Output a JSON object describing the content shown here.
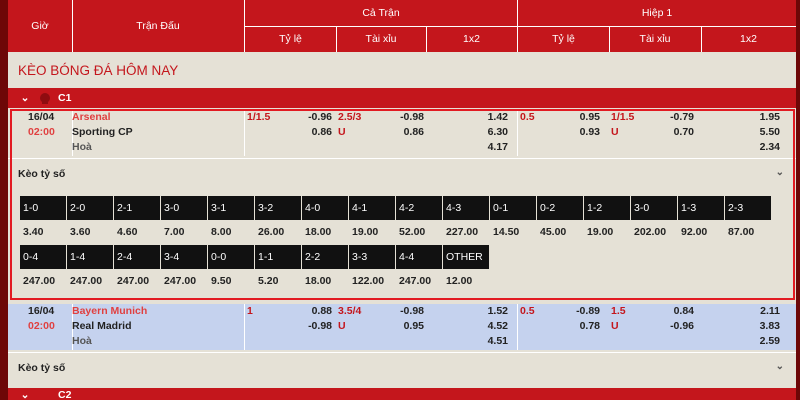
{
  "header": {
    "time": "Giờ",
    "match": "Trận Đấu",
    "full_time": "Cả Trận",
    "first_half": "Hiệp 1",
    "handicap": "Tỷ lệ",
    "over_under": "Tài xỉu",
    "one_x_two": "1x2",
    "handicap_h1": "Tỷ lệ",
    "over_under_h1": "Tài xỉu",
    "one_x_two_h1": "1x2"
  },
  "title": "KÈO BÓNG ĐÁ HÔM NAY",
  "colors": {
    "primary_red": "#c4161c",
    "highlight_blue": "#c5d2ee",
    "background": "#e5e1d6"
  },
  "leagues": [
    {
      "name": "C1",
      "matches": [
        {
          "date": "16/04",
          "time": "02:00",
          "home": "Arsenal",
          "away": "Sporting CP",
          "draw": "Hoà",
          "ft_hdp_line": "1/1.5",
          "ft_hdp_home": "-0.96",
          "ft_hdp_away": "0.86",
          "ft_ou_line": "2.5/3",
          "ft_ou_under": "U",
          "ft_ou_over_odds": "-0.98",
          "ft_ou_under_odds": "0.86",
          "ft_1": "1.42",
          "ft_2": "6.30",
          "ft_x": "4.17",
          "h1_hdp_line": "0.5",
          "h1_hdp_home": "0.95",
          "h1_hdp_away": "0.93",
          "h1_ou_line": "1/1.5",
          "h1_ou_under": "U",
          "h1_ou_over_odds": "-0.79",
          "h1_ou_under_odds": "0.70",
          "h1_1": "1.95",
          "h1_2": "5.50",
          "h1_x": "2.34",
          "correct_score_label": "Kèo tỷ số",
          "correct_score_row1": [
            {
              "score": "1-0",
              "odds": "3.40"
            },
            {
              "score": "2-0",
              "odds": "3.60"
            },
            {
              "score": "2-1",
              "odds": "4.60"
            },
            {
              "score": "3-0",
              "odds": "7.00"
            },
            {
              "score": "3-1",
              "odds": "8.00"
            },
            {
              "score": "3-2",
              "odds": "26.00"
            },
            {
              "score": "4-0",
              "odds": "18.00"
            },
            {
              "score": "4-1",
              "odds": "19.00"
            },
            {
              "score": "4-2",
              "odds": "52.00"
            },
            {
              "score": "4-3",
              "odds": "227.00"
            },
            {
              "score": "0-1",
              "odds": "14.50"
            },
            {
              "score": "0-2",
              "odds": "45.00"
            },
            {
              "score": "1-2",
              "odds": "19.00"
            },
            {
              "score": "3-0",
              "odds": "202.00"
            },
            {
              "score": "1-3",
              "odds": "92.00"
            },
            {
              "score": "2-3",
              "odds": "87.00"
            }
          ],
          "correct_score_row2": [
            {
              "score": "0-4",
              "odds": "247.00"
            },
            {
              "score": "1-4",
              "odds": "247.00"
            },
            {
              "score": "2-4",
              "odds": "247.00"
            },
            {
              "score": "3-4",
              "odds": "247.00"
            },
            {
              "score": "0-0",
              "odds": "9.50"
            },
            {
              "score": "1-1",
              "odds": "5.20"
            },
            {
              "score": "2-2",
              "odds": "18.00"
            },
            {
              "score": "3-3",
              "odds": "122.00"
            },
            {
              "score": "4-4",
              "odds": "247.00"
            },
            {
              "score": "OTHER",
              "odds": "12.00"
            }
          ]
        },
        {
          "date": "16/04",
          "time": "02:00",
          "home": "Bayern Munich",
          "away": "Real Madrid",
          "draw": "Hoà",
          "ft_hdp_line": "1",
          "ft_hdp_home": "0.88",
          "ft_hdp_away": "-0.98",
          "ft_ou_line": "3.5/4",
          "ft_ou_under": "U",
          "ft_ou_over_odds": "-0.98",
          "ft_ou_under_odds": "0.95",
          "ft_1": "1.52",
          "ft_2": "4.52",
          "ft_x": "4.51",
          "h1_hdp_line": "0.5",
          "h1_hdp_home": "-0.89",
          "h1_hdp_away": "0.78",
          "h1_ou_line": "1.5",
          "h1_ou_under": "U",
          "h1_ou_over_odds": "0.84",
          "h1_ou_under_odds": "-0.96",
          "h1_1": "2.11",
          "h1_2": "3.83",
          "h1_x": "2.59",
          "correct_score_label": "Kèo tỷ số"
        }
      ]
    },
    {
      "name": "C2"
    }
  ]
}
